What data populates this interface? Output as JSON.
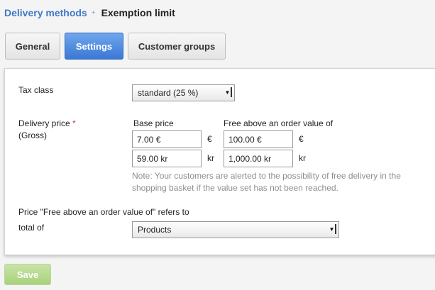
{
  "breadcrumb": {
    "parent": "Delivery methods",
    "separator": "+",
    "current": "Exemption limit"
  },
  "tabs": [
    {
      "label": "General",
      "active": false
    },
    {
      "label": "Settings",
      "active": true
    },
    {
      "label": "Customer groups",
      "active": false
    }
  ],
  "form": {
    "tax_class": {
      "label": "Tax class",
      "value": "standard (25 %)"
    },
    "delivery_price": {
      "label": "Delivery price",
      "required_mark": "*",
      "sublabel": "(Gross)",
      "base_header": "Base price",
      "free_header": "Free above an order value of",
      "rows": [
        {
          "base": "7.00 €",
          "base_unit": "€",
          "free": "100.00 €",
          "free_unit": "€"
        },
        {
          "base": "59.00 kr",
          "base_unit": "kr",
          "free": "1,000.00 kr",
          "free_unit": "kr"
        }
      ],
      "note": "Note: Your customers are alerted to the possibility of free delivery in the shopping basket if the value set has not been reached."
    },
    "refers_to": {
      "label_line1": "Price \"Free above an order value of\" refers to",
      "label_line2": "total of",
      "value": "Products"
    }
  },
  "save_label": "Save",
  "colors": {
    "link": "#3f79c8",
    "active_tab": "#3b78d5",
    "save_button": "#a8d27b",
    "required": "#dd3333"
  }
}
